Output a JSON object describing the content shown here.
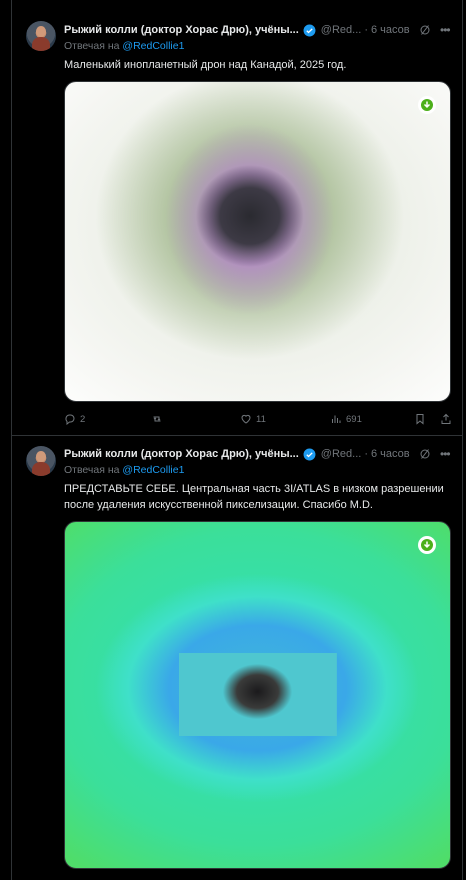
{
  "tweets": [
    {
      "author_name": "Рыжий колли (доктор Хорас Дрю), учёны...",
      "handle": "@Red...",
      "separator": "·",
      "time": "6 часов",
      "reply_prefix": "Отвечая на",
      "reply_mention": "@RedCollie1",
      "text": "Маленький инопланетный дрон над Канадой, 2025 год.",
      "stats": {
        "replies": "2",
        "likes": "11",
        "views": "691"
      }
    },
    {
      "author_name": "Рыжий колли (доктор Хорас Дрю), учёны...",
      "handle": "@Red...",
      "separator": "·",
      "time": "6 часов",
      "reply_prefix": "Отвечая на",
      "reply_mention": "@RedCollie1",
      "text": "ПРЕДСТАВЬТЕ СЕБЕ. Центральная часть 3I/ATLAS в низком разрешении после удаления искусственной пикселизации. Спасибо M.D."
    }
  ],
  "icons": {
    "verified": "verified-badge-icon",
    "grok": "grok-icon",
    "more": "more-icon",
    "download": "download-icon",
    "reply": "reply-icon",
    "retweet": "retweet-icon",
    "like": "heart-icon",
    "views": "views-icon",
    "bookmark": "bookmark-icon",
    "share": "share-icon"
  },
  "colors": {
    "background": "#000000",
    "text": "#e7e9ea",
    "muted": "#71767b",
    "link": "#1d9bf0",
    "border": "#2f3336",
    "download_badge": "#4caf1a"
  }
}
